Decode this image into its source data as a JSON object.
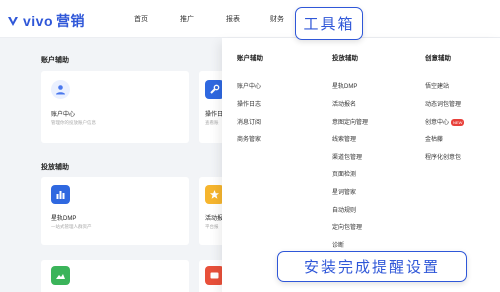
{
  "app": {
    "brand": "vivo",
    "brand_suffix": "营销"
  },
  "nav": [
    "首页",
    "推广",
    "报表",
    "财务"
  ],
  "tooltip_top": "工具箱",
  "main": {
    "section1_title": "账户辅助",
    "card1_title": "账户中心",
    "card1_desc": "管理你的投放账户信息",
    "card2_title": "操作日",
    "card2_desc": "查看账",
    "section2_title": "投放辅助",
    "card3_title": "星轨DMP",
    "card3_desc": "一站式管理人群资产",
    "card4_title": "活动报",
    "card4_desc": "平台报"
  },
  "dropdown": {
    "col1_head": "账户辅助",
    "col1_items": [
      "账户中心",
      "操作日志",
      "消息订阅",
      "商务管家"
    ],
    "col2_head": "投放辅助",
    "col2_items": [
      "星轨DMP",
      "活动报名",
      "意图定向管理",
      "线索管理",
      "渠道包管理",
      "页面检测",
      "星词管家",
      "自动规则",
      "定向包管理",
      "诊断"
    ],
    "col3_head": "创意辅助",
    "col3_items": [
      "悟空建站",
      "动态词包管理",
      "创意中心",
      "金枯藤",
      "程序化创意包"
    ],
    "new_badge": "NEW"
  },
  "tooltip_bottom": "安装完成提醒设置",
  "colors": {
    "brand": "#2f57d8",
    "accent_red": "#e8403a"
  }
}
